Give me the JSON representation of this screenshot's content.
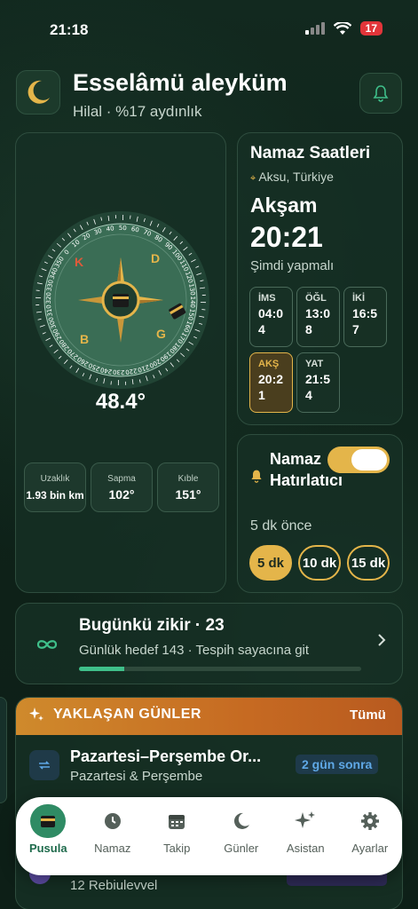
{
  "status": {
    "time": "21:18",
    "battery": "17"
  },
  "header": {
    "greeting": "Esselâmü aleyküm",
    "moon_info": "Hilal · %17 aydınlık"
  },
  "compass": {
    "heading": "48.4°",
    "letters": [
      "K",
      "D",
      "G",
      "B"
    ],
    "stats": [
      {
        "label": "Uzaklık",
        "value": "1.93 bin km"
      },
      {
        "label": "Sapma",
        "value": "102°"
      },
      {
        "label": "Kıble",
        "value": "151°"
      }
    ]
  },
  "prayer": {
    "title": "Namaz Saatleri",
    "location": "Aksu, Türkiye",
    "current_name": "Akşam",
    "current_time": "20:21",
    "now_text": "Şimdi yapmalı",
    "times": [
      {
        "name": "İMS",
        "time": "04:04"
      },
      {
        "name": "ÖĞL",
        "time": "13:08"
      },
      {
        "name": "İKİ",
        "time": "16:57"
      },
      {
        "name": "AKŞ",
        "time": "20:21"
      },
      {
        "name": "YAT",
        "time": "21:54"
      }
    ]
  },
  "reminder": {
    "title": "Namaz Hatırlatıcı",
    "ago": "5 dk önce",
    "options": [
      "5 dk",
      "10 dk",
      "15 dk"
    ],
    "enabled": true
  },
  "zikir": {
    "title": "Bugünkü zikir · 23",
    "subtitle": "Günlük hedef 143 · Tespih sayacına git",
    "progress": 0.16
  },
  "upcoming": {
    "title": "YAKLAŞAN GÜNLER",
    "all_label": "Tümü",
    "events": [
      {
        "title": "Pazartesi–Perşembe Or...",
        "subtitle": "Pazartesi & Perşembe",
        "badge": "2 gün sonra"
      },
      {
        "subtitle": "12 Rebiulevvel"
      }
    ]
  },
  "tabs": [
    {
      "label": "Pusula",
      "icon": "kaaba-icon"
    },
    {
      "label": "Namaz",
      "icon": "clock-icon"
    },
    {
      "label": "Takip",
      "icon": "calendar-icon"
    },
    {
      "label": "Günler",
      "icon": "moon-icon"
    },
    {
      "label": "Asistan",
      "icon": "sparkle-icon"
    },
    {
      "label": "Ayarlar",
      "icon": "gear-icon"
    }
  ],
  "colors": {
    "accent_gold": "#e4b54a",
    "accent_green": "#2f8b64",
    "background": "#0f241c"
  }
}
